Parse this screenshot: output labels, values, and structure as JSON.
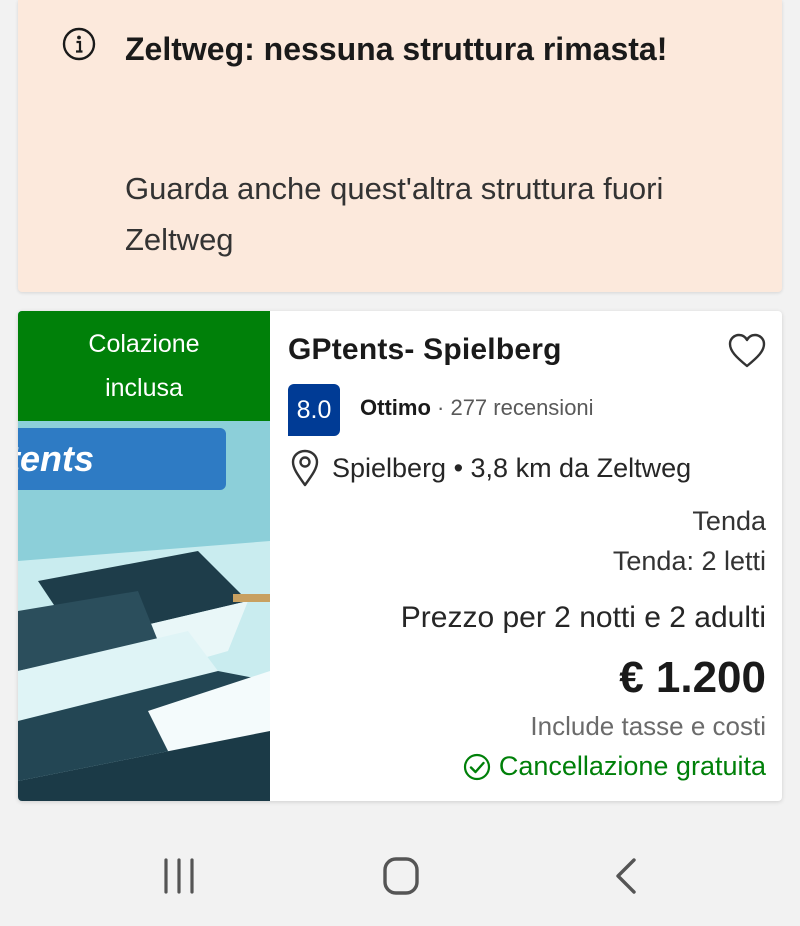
{
  "notice": {
    "icon": "info-icon",
    "title": "Zeltweg: nessuna struttura rimasta!",
    "subtitle": "Guarda anche quest'altra struttura fuori Zeltweg"
  },
  "property": {
    "image_badge": "Colazione inclusa",
    "image_sign_text": "tents",
    "name": "GPtents- Spielberg",
    "score": "8.0",
    "score_word": "Ottimo",
    "reviews": "· 277 recensioni",
    "location": "Spielberg • 3,8 km da Zeltweg",
    "room_type": "Tenda",
    "beds": "Tenda: 2 letti",
    "price_label": "Prezzo per 2 notti e 2 adulti",
    "price": "€ 1.200",
    "taxes": "Include tasse e costi",
    "cancellation": "Cancellazione gratuita"
  },
  "colors": {
    "notice_bg": "#fce9dc",
    "badge_green": "#008009",
    "score_blue": "#003b95",
    "cancel_green": "#008009"
  },
  "navbar": {
    "items": [
      "recent-apps-icon",
      "home-icon",
      "back-icon"
    ]
  }
}
